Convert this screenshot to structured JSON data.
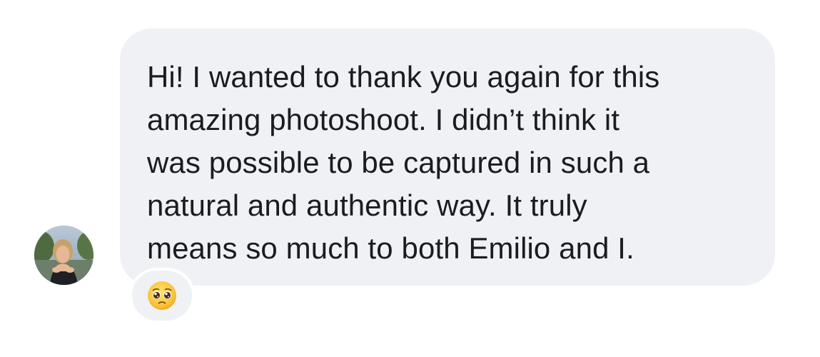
{
  "message": {
    "lines": [
      "Hi! I wanted to thank you again for this",
      "amazing photoshoot. I didn’t think it",
      "was possible to be captured in such a",
      "natural and authentic way. It truly",
      "means so much to both Emilio and I."
    ]
  },
  "reaction": {
    "emoji": "pleading-face-emoji"
  },
  "colors": {
    "bubble": "#f0f1f4",
    "text": "#1b1c1f",
    "background": "#ffffff"
  }
}
